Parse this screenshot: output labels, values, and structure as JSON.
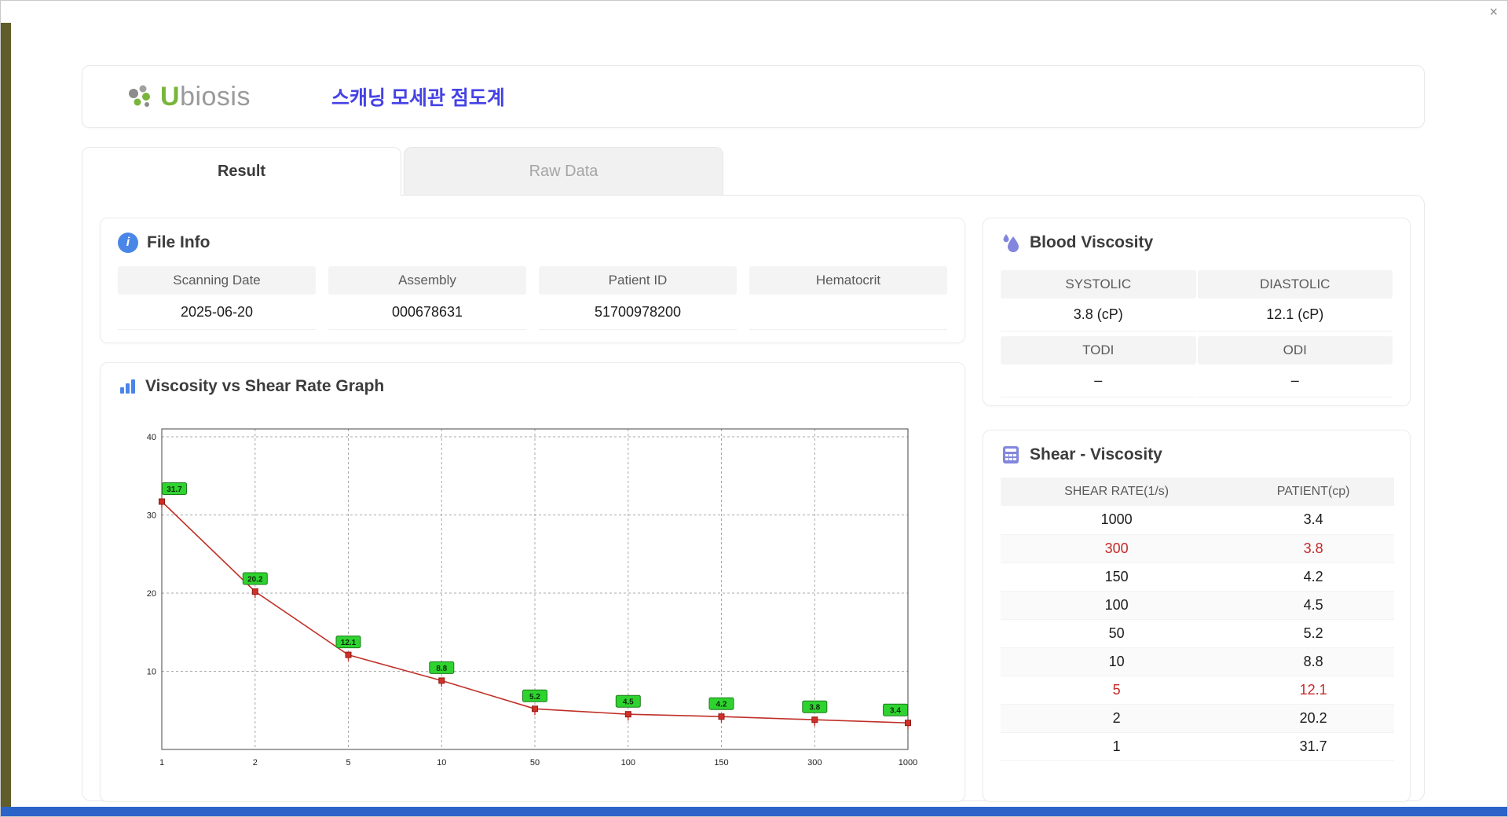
{
  "window": {
    "close_label": "×"
  },
  "header": {
    "logo_prefix": "U",
    "logo_suffix": "biosis",
    "title": "스캐닝 모세관 점도계"
  },
  "tabs": {
    "result": "Result",
    "raw_data": "Raw Data"
  },
  "file_info": {
    "title": "File Info",
    "fields": [
      {
        "label": "Scanning Date",
        "value": "2025-06-20"
      },
      {
        "label": "Assembly",
        "value": "000678631"
      },
      {
        "label": "Patient ID",
        "value": "51700978200"
      },
      {
        "label": "Hematocrit",
        "value": ""
      }
    ]
  },
  "blood_viscosity": {
    "title": "Blood Viscosity",
    "systolic_label": "SYSTOLIC",
    "diastolic_label": "DIASTOLIC",
    "systolic_value": "3.8 (cP)",
    "diastolic_value": "12.1 (cP)",
    "todi_label": "TODI",
    "odi_label": "ODI",
    "todi_value": "–",
    "odi_value": "–"
  },
  "shear_viscosity": {
    "title": "Shear - Viscosity",
    "columns": [
      "SHEAR RATE(1/s)",
      "PATIENT(cp)"
    ],
    "rows": [
      {
        "shear": "1000",
        "patient": "3.4",
        "highlight": false
      },
      {
        "shear": "300",
        "patient": "3.8",
        "highlight": true
      },
      {
        "shear": "150",
        "patient": "4.2",
        "highlight": false
      },
      {
        "shear": "100",
        "patient": "4.5",
        "highlight": false
      },
      {
        "shear": "50",
        "patient": "5.2",
        "highlight": false
      },
      {
        "shear": "10",
        "patient": "8.8",
        "highlight": false
      },
      {
        "shear": "5",
        "patient": "12.1",
        "highlight": true
      },
      {
        "shear": "2",
        "patient": "20.2",
        "highlight": false
      },
      {
        "shear": "1",
        "patient": "31.7",
        "highlight": false
      }
    ]
  },
  "graph": {
    "title": "Viscosity vs Shear Rate Graph"
  },
  "chart_data": {
    "type": "line",
    "title": "Viscosity vs Shear Rate Graph",
    "x_scale": "categorical",
    "categories": [
      "1",
      "2",
      "5",
      "10",
      "50",
      "100",
      "150",
      "300",
      "1000"
    ],
    "values": [
      31.7,
      20.2,
      12.1,
      8.8,
      5.2,
      4.5,
      4.2,
      3.8,
      3.4
    ],
    "xlabel": "",
    "ylabel": "",
    "ylim": [
      0,
      41
    ],
    "yticks": [
      10,
      20,
      30,
      40
    ],
    "grid": true,
    "legend": false,
    "line_color": "#c03028",
    "marker_color": "#d03028",
    "marker_border": "#8f1d14",
    "point_label_bg": "#2fd32f",
    "point_label_border": "#1f7a1f"
  },
  "colors": {
    "accent_blue": "#4542e6",
    "icon_blue": "#4a86e8",
    "icon_purple": "#8287dd",
    "logo_green": "#79b53a",
    "highlight_red": "#c62828",
    "header_cell_bg": "#f4f4f4",
    "edge_strip_olive": "#615d2b",
    "edge_strip_blue": "#2c63c8"
  }
}
